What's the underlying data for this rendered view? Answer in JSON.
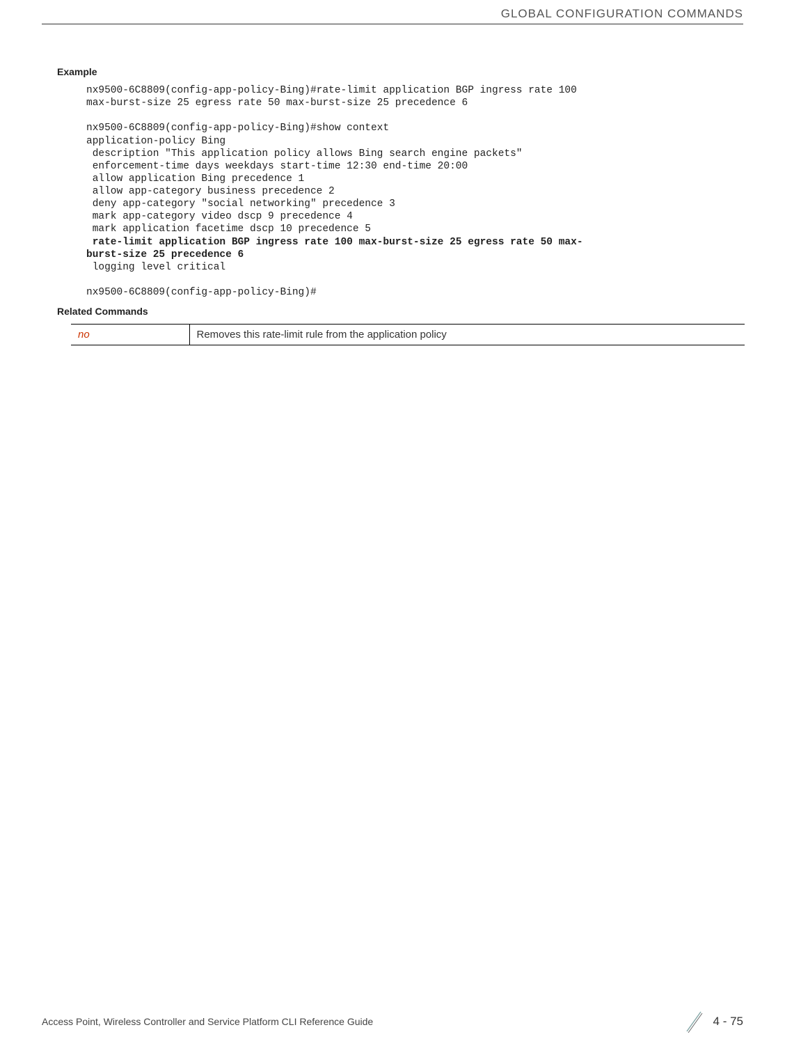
{
  "header": {
    "section_title": "GLOBAL CONFIGURATION COMMANDS"
  },
  "headings": {
    "example": "Example",
    "related": "Related Commands"
  },
  "code": {
    "line1": "nx9500-6C8809(config-app-policy-Bing)#rate-limit application BGP ingress rate 100 ",
    "line2": "max-burst-size 25 egress rate 50 max-burst-size 25 precedence 6",
    "blank1": "",
    "line3": "nx9500-6C8809(config-app-policy-Bing)#show context",
    "line4": "application-policy Bing",
    "line5": " description \"This application policy allows Bing search engine packets\"",
    "line6": " enforcement-time days weekdays start-time 12:30 end-time 20:00",
    "line7": " allow application Bing precedence 1",
    "line8": " allow app-category business precedence 2",
    "line9": " deny app-category \"social networking\" precedence 3",
    "line10": " mark app-category video dscp 9 precedence 4",
    "line11": " mark application facetime dscp 10 precedence 5",
    "bold1": " rate-limit application BGP ingress rate 100 max-burst-size 25 egress rate 50 max-",
    "bold2": "burst-size 25 precedence 6",
    "line12": " logging level critical",
    "blank2": "",
    "line13": "nx9500-6C8809(config-app-policy-Bing)#"
  },
  "related_table": {
    "cmd": "no",
    "desc": "Removes this rate-limit rule from the application policy"
  },
  "footer": {
    "guide": "Access Point, Wireless Controller and Service Platform CLI Reference Guide",
    "page": "4 - 75"
  }
}
